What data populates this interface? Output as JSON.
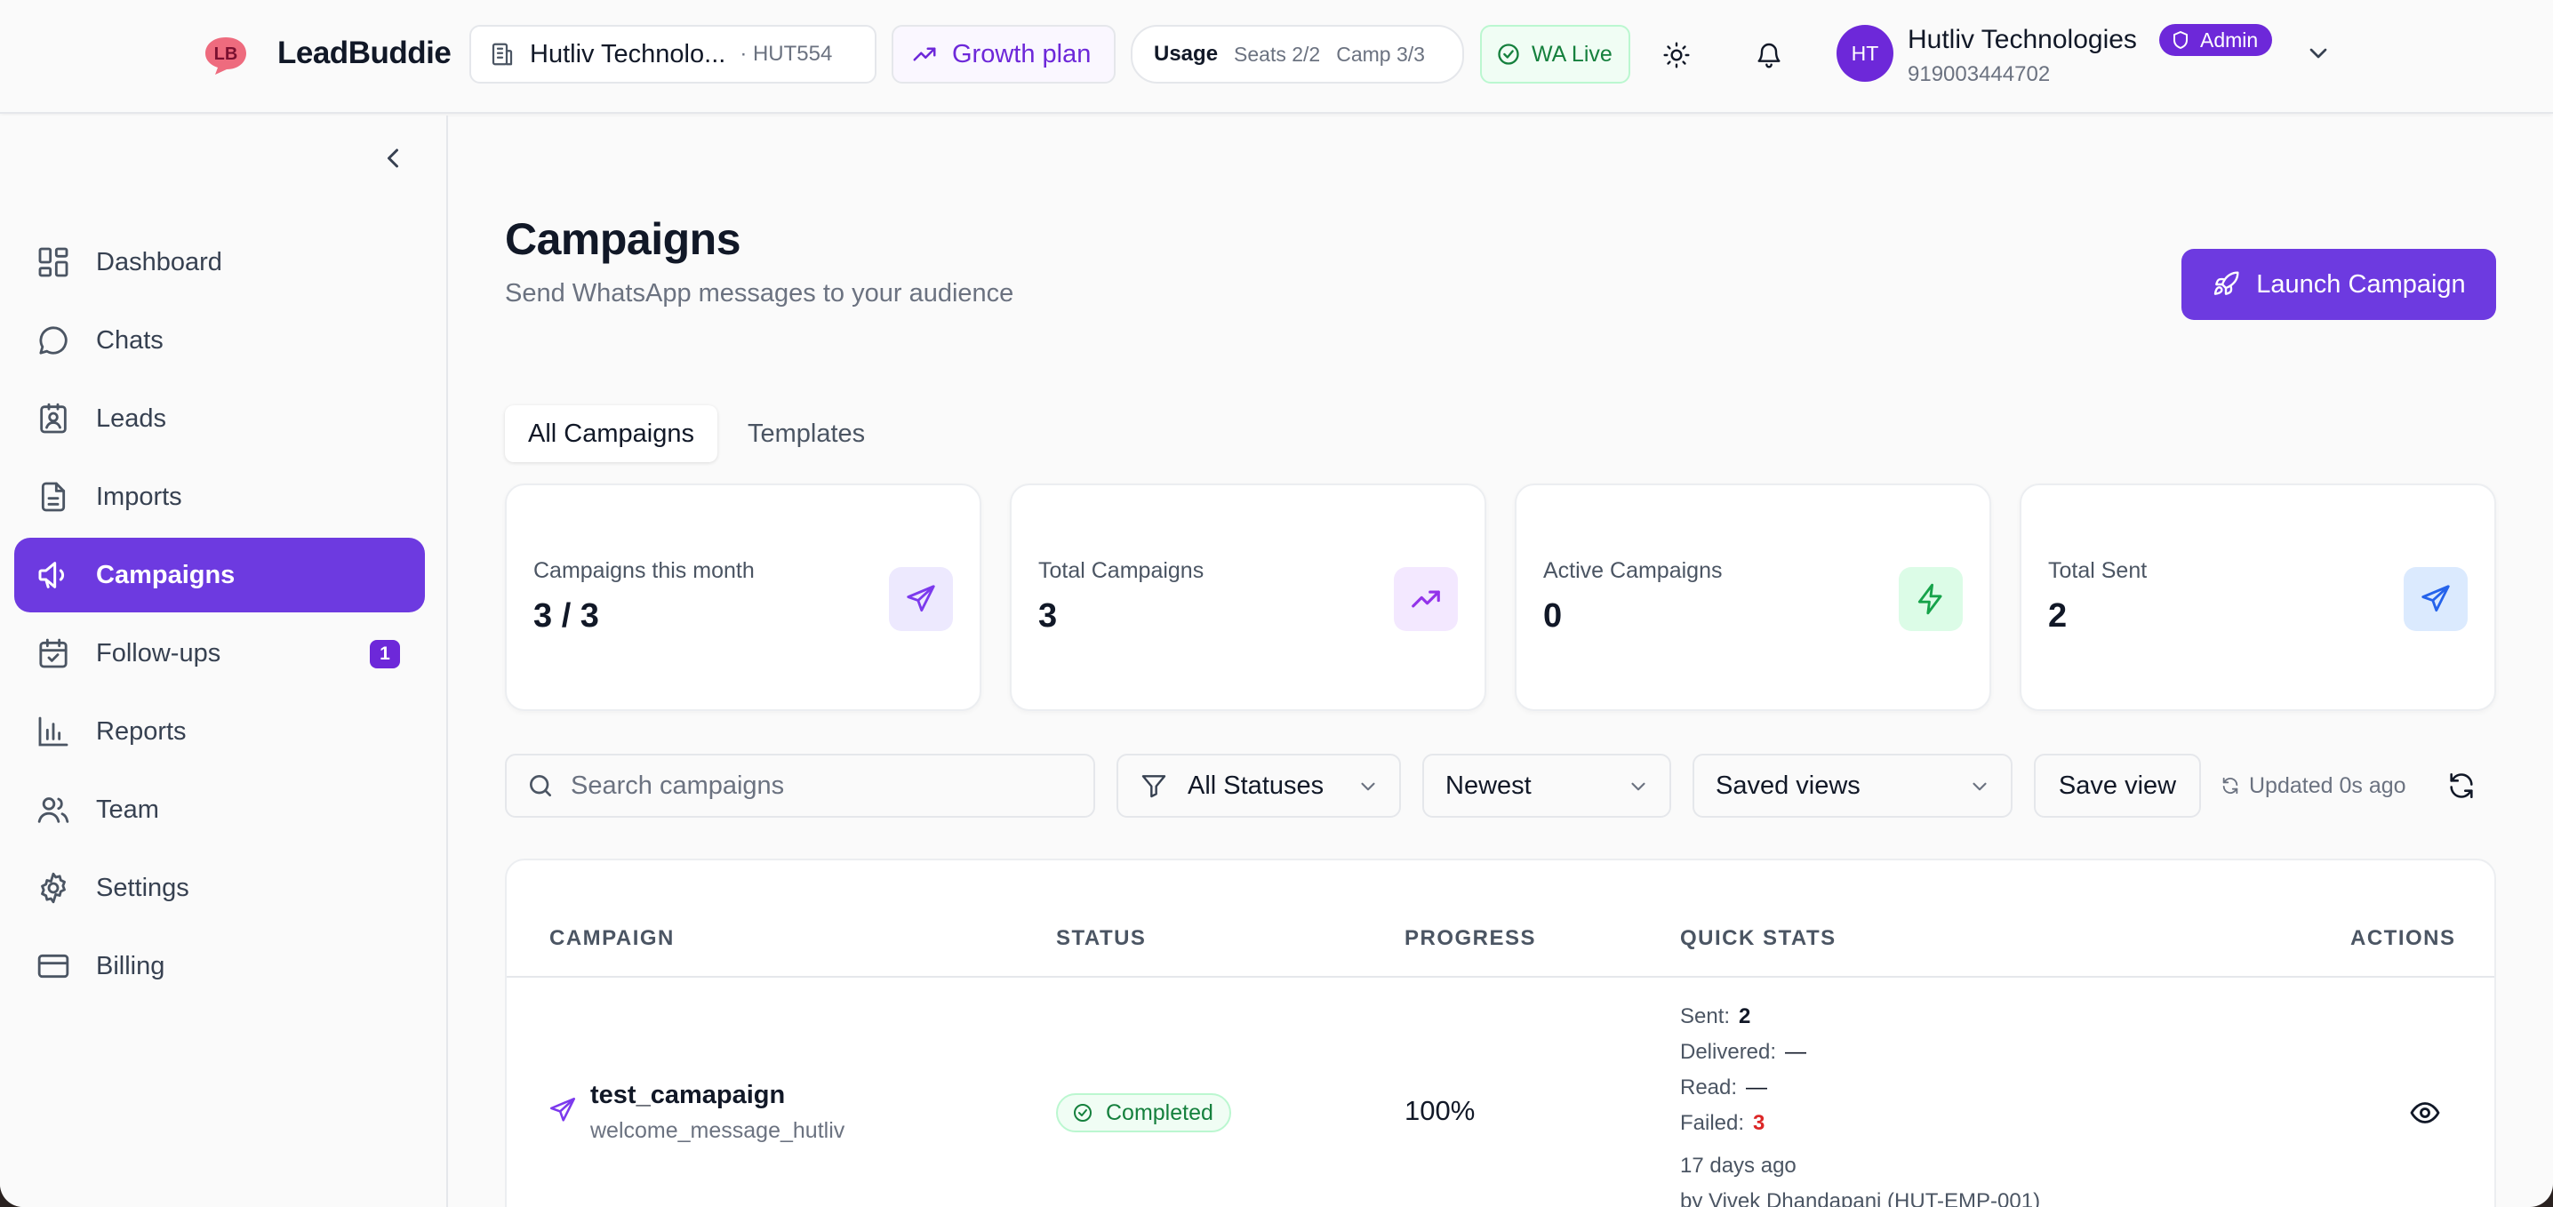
{
  "topbar": {
    "brand": "LeadBuddie",
    "org_name": "Hutliv Technolo...",
    "org_code": "· HUT554",
    "plan": "Growth plan",
    "usage_title": "Usage",
    "usage_seats": "Seats 2/2",
    "usage_camp": "Camp 3/3",
    "wa_status": "WA Live",
    "avatar_initials": "HT",
    "user_name": "Hutliv Technologies",
    "role_badge": "Admin",
    "phone": "919003444702"
  },
  "sidebar": {
    "items": [
      {
        "label": "Dashboard",
        "icon": "grid-icon"
      },
      {
        "label": "Chats",
        "icon": "chat-bubble-icon"
      },
      {
        "label": "Leads",
        "icon": "contact-card-icon"
      },
      {
        "label": "Imports",
        "icon": "document-icon"
      },
      {
        "label": "Campaigns",
        "icon": "megaphone-icon",
        "active": true
      },
      {
        "label": "Follow-ups",
        "icon": "calendar-check-icon",
        "badge": "1"
      },
      {
        "label": "Reports",
        "icon": "bar-chart-icon"
      },
      {
        "label": "Team",
        "icon": "users-icon"
      },
      {
        "label": "Settings",
        "icon": "gear-icon"
      },
      {
        "label": "Billing",
        "icon": "credit-card-icon"
      }
    ]
  },
  "main": {
    "title": "Campaigns",
    "subtitle": "Send WhatsApp messages to your audience",
    "launch_label": "Launch Campaign",
    "tabs": [
      {
        "label": "All Campaigns",
        "active": true
      },
      {
        "label": "Templates"
      }
    ],
    "stats": [
      {
        "label": "Campaigns this month",
        "value": "3 / 3",
        "icon": "send-icon",
        "color": "#7c3aed"
      },
      {
        "label": "Total Campaigns",
        "value": "3",
        "icon": "trending-up-icon",
        "color": "#9333ea"
      },
      {
        "label": "Active Campaigns",
        "value": "0",
        "icon": "bolt-icon",
        "color": "#16a34a"
      },
      {
        "label": "Total Sent",
        "value": "2",
        "icon": "send-icon",
        "color": "#2563eb"
      }
    ],
    "filters": {
      "search_placeholder": "Search campaigns",
      "status": "All Statuses",
      "sort": "Newest",
      "saved_views": "Saved views",
      "save_view": "Save view",
      "updated": "Updated 0s ago"
    },
    "table": {
      "headers": [
        "CAMPAIGN",
        "STATUS",
        "PROGRESS",
        "QUICK STATS",
        "ACTIONS"
      ],
      "rows": [
        {
          "name": "test_camapaign",
          "template": "welcome_message_hutliv",
          "status": "Completed",
          "progress": "100%",
          "sent_label": "Sent:",
          "sent": "2",
          "delivered_label": "Delivered:",
          "delivered": "—",
          "read_label": "Read:",
          "read": "—",
          "failed_label": "Failed:",
          "failed": "3",
          "time": "17 days ago",
          "by": "by Vivek Dhandapani (HUT-EMP-001)"
        }
      ]
    }
  },
  "colors": {
    "accent": "#6d3ae0",
    "success": "#15803d",
    "danger": "#dc2626"
  }
}
